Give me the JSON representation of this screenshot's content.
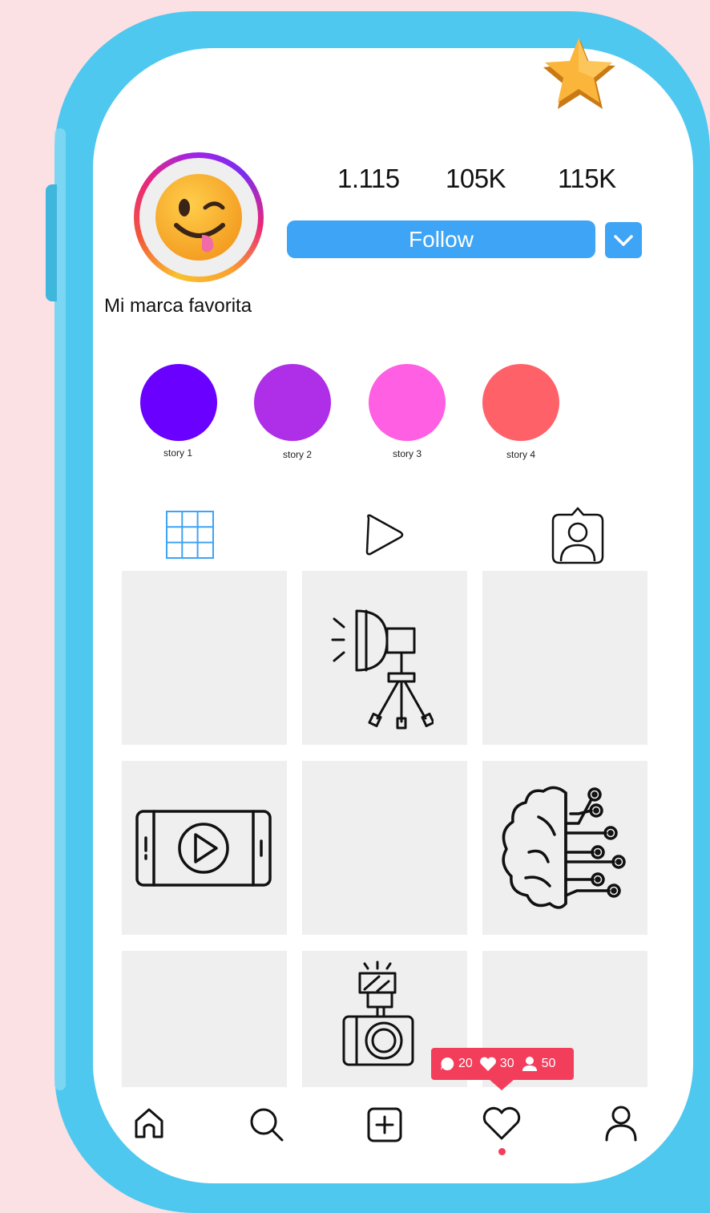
{
  "profile": {
    "name": "Mi marca favorita",
    "stats": [
      "1.115",
      "105K",
      "115K"
    ],
    "follow_label": "Follow",
    "dropdown_icon": "chevron-down-icon",
    "avatar_icon": "winking-tongue-emoji"
  },
  "stories": [
    {
      "label": "story 1",
      "color": "#6a00ff"
    },
    {
      "label": "story 2",
      "color": "#af2ee8"
    },
    {
      "label": "story 3",
      "color": "#ff5fe3"
    },
    {
      "label": "story 4",
      "color": "#ff6169"
    }
  ],
  "tabs": [
    {
      "icon": "grid-icon",
      "active": true
    },
    {
      "icon": "play-icon",
      "active": false
    },
    {
      "icon": "tagged-user-icon",
      "active": false
    }
  ],
  "grid_icons": [
    "",
    "studio-light-icon",
    "",
    "video-player-icon",
    "",
    "ai-brain-icon",
    "",
    "camera-flash-icon",
    ""
  ],
  "notification": {
    "comments": "20",
    "likes": "30",
    "followers": "50"
  },
  "nav": [
    "home-icon",
    "search-icon",
    "add-post-icon",
    "heart-icon",
    "profile-icon"
  ],
  "colors": {
    "accent": "#3ea4f5",
    "frame": "#4ec8ef",
    "notification": "#f33e5b",
    "background": "#fbe0e4"
  }
}
